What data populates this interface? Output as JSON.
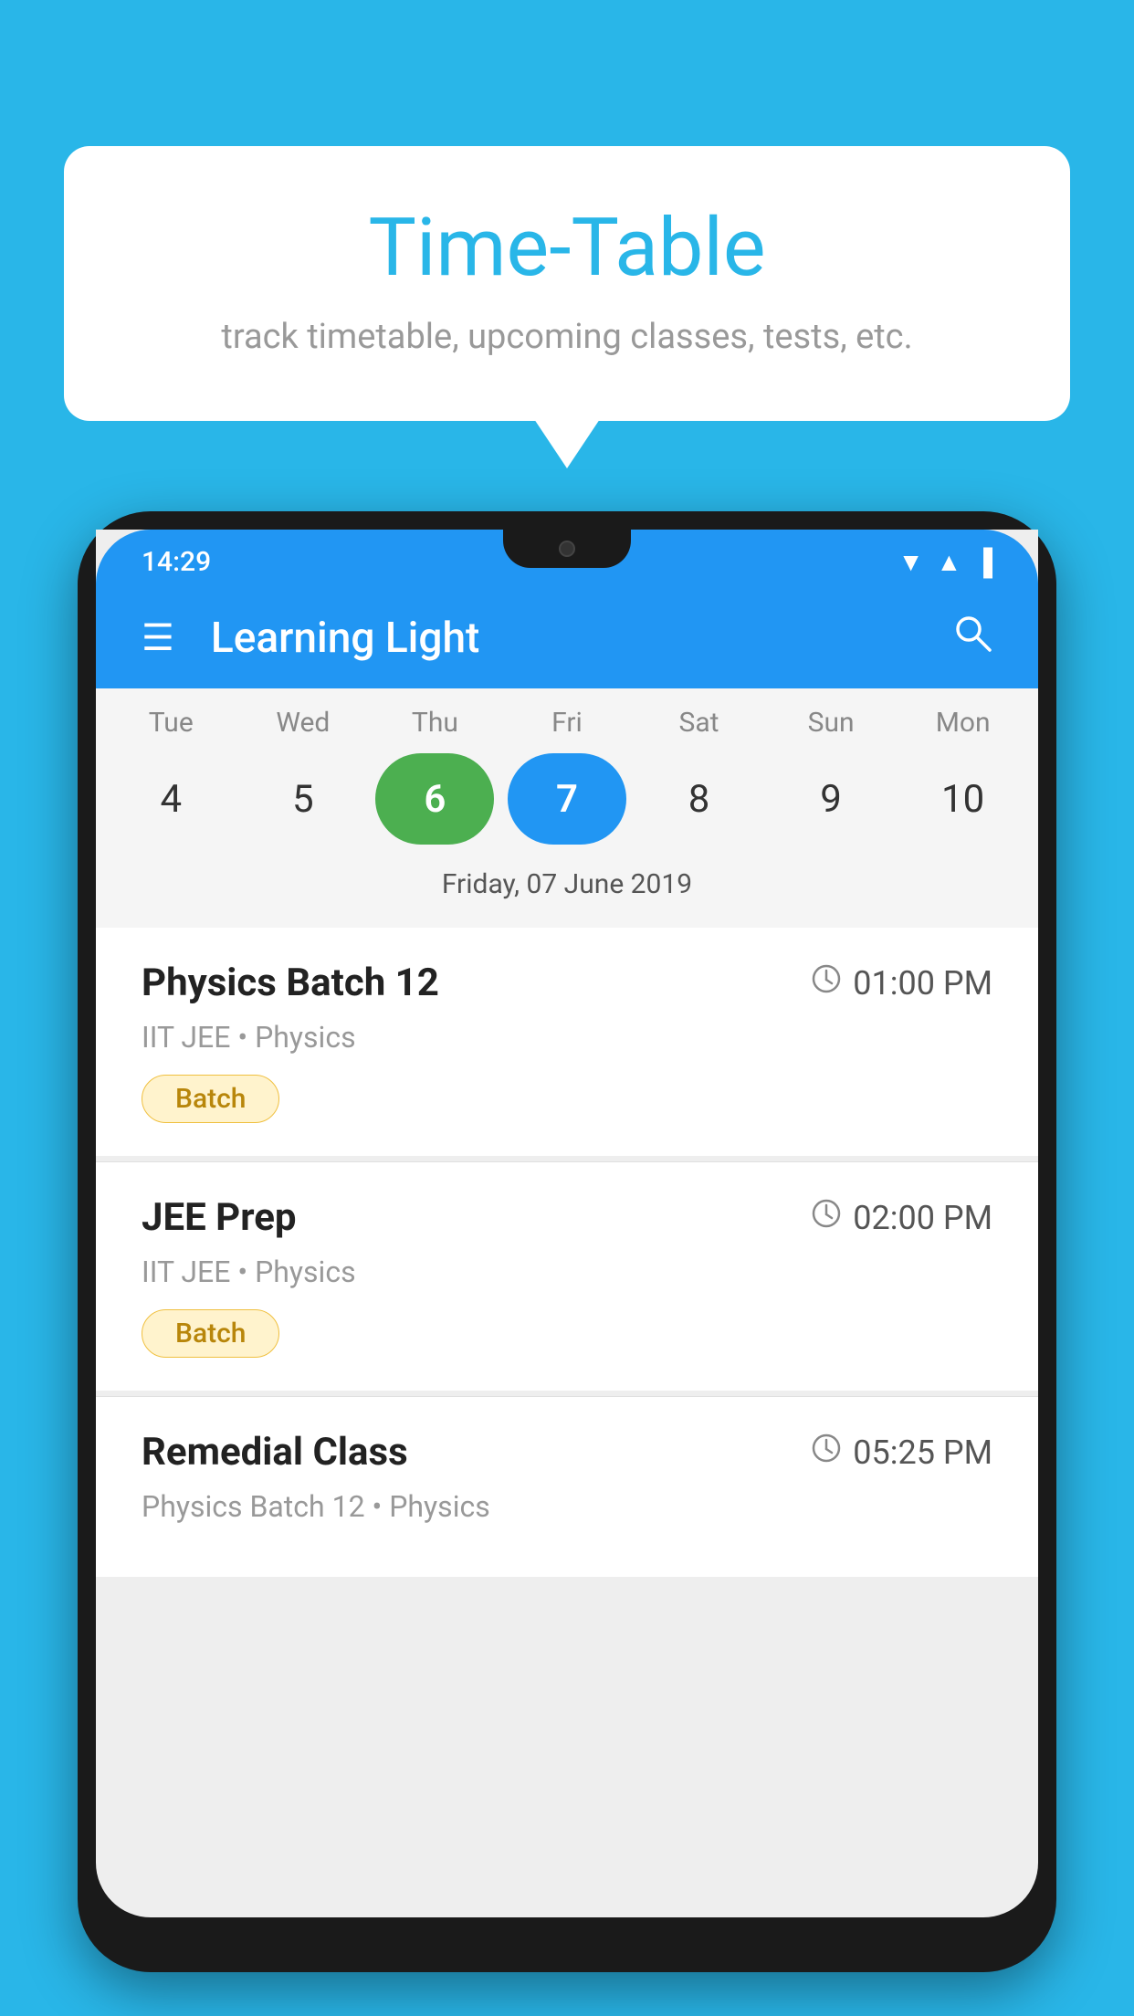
{
  "background_color": "#29B6E8",
  "bubble": {
    "title": "Time-Table",
    "subtitle": "track timetable, upcoming classes, tests, etc."
  },
  "phone": {
    "status_bar": {
      "time": "14:29",
      "wifi": "▾",
      "signal": "▲",
      "battery": "▐"
    },
    "header": {
      "title": "Learning Light",
      "hamburger_label": "☰",
      "search_label": "🔍"
    },
    "calendar": {
      "days": [
        {
          "label": "Tue",
          "num": "4"
        },
        {
          "label": "Wed",
          "num": "5"
        },
        {
          "label": "Thu",
          "num": "6",
          "state": "today"
        },
        {
          "label": "Fri",
          "num": "7",
          "state": "selected"
        },
        {
          "label": "Sat",
          "num": "8"
        },
        {
          "label": "Sun",
          "num": "9"
        },
        {
          "label": "Mon",
          "num": "10"
        }
      ],
      "selected_date_label": "Friday, 07 June 2019"
    },
    "sessions": [
      {
        "name": "Physics Batch 12",
        "time": "01:00 PM",
        "meta": "IIT JEE • Physics",
        "tag": "Batch"
      },
      {
        "name": "JEE Prep",
        "time": "02:00 PM",
        "meta": "IIT JEE • Physics",
        "tag": "Batch"
      },
      {
        "name": "Remedial Class",
        "time": "05:25 PM",
        "meta": "Physics Batch 12 • Physics",
        "tag": ""
      }
    ]
  }
}
